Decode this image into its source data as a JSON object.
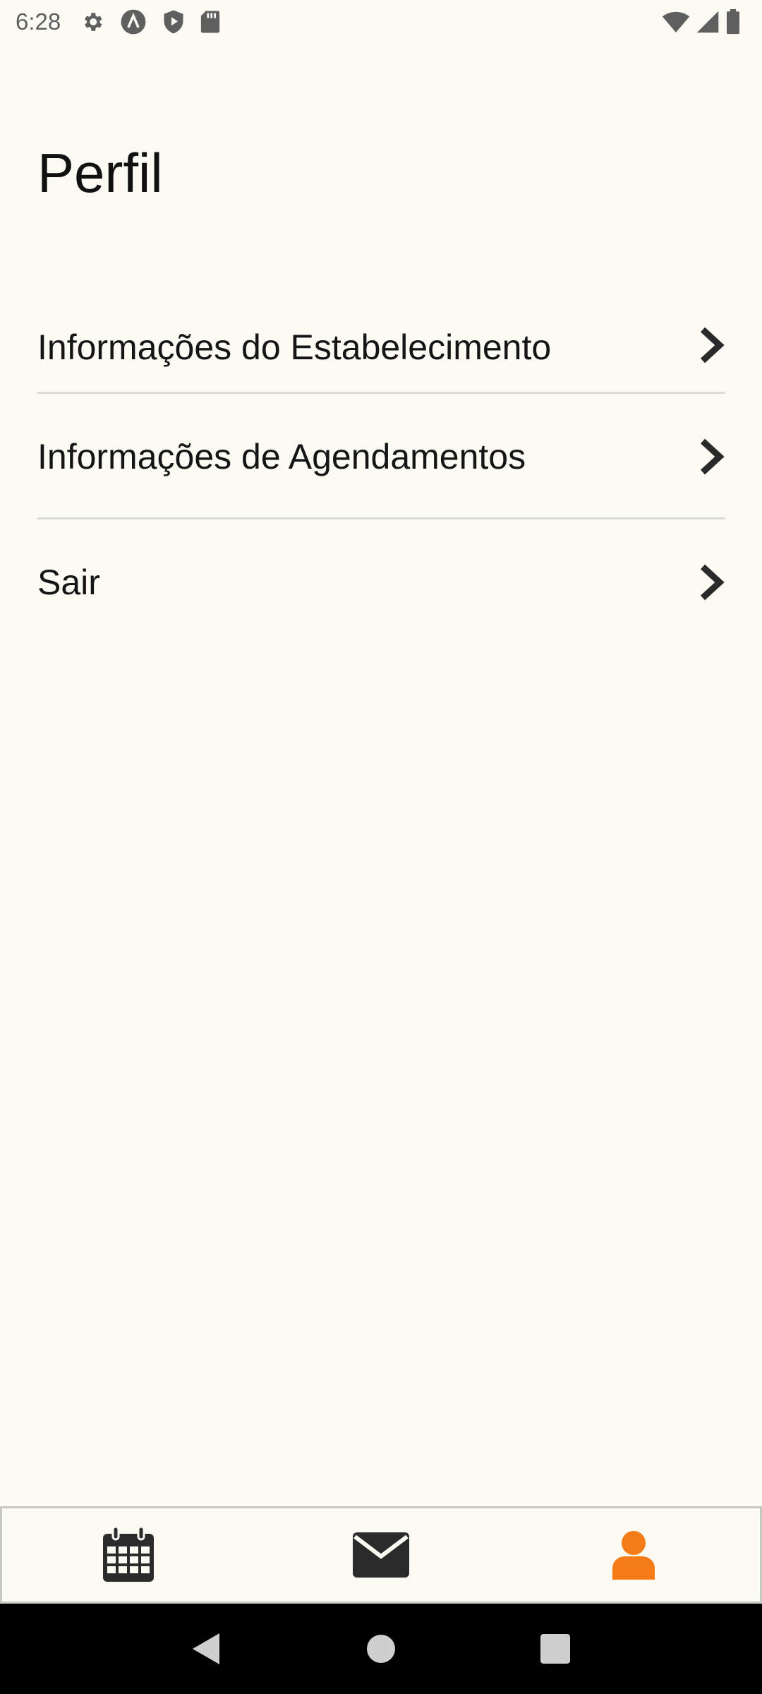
{
  "status_bar": {
    "time": "6:28",
    "left_icons": [
      "gear-icon",
      "a-circle-icon",
      "play-shield-icon",
      "sd-card-icon"
    ],
    "right_icons": [
      "wifi-icon",
      "signal-icon",
      "battery-icon"
    ]
  },
  "page": {
    "title": "Perfil"
  },
  "menu": {
    "items": [
      {
        "label": "Informações do Estabelecimento",
        "icon": "chevron-right-icon"
      },
      {
        "label": "Informações de Agendamentos",
        "icon": "chevron-right-icon"
      },
      {
        "label": "Sair",
        "icon": "chevron-right-icon"
      }
    ]
  },
  "tab_bar": {
    "tabs": [
      {
        "icon": "calendar-icon",
        "active": false
      },
      {
        "icon": "envelope-icon",
        "active": false
      },
      {
        "icon": "user-icon",
        "active": true
      }
    ],
    "colors": {
      "active": "#f47b16",
      "inactive": "#2b2b2b"
    }
  },
  "nav_bar": {
    "buttons": [
      "back-icon",
      "home-icon",
      "recents-icon"
    ]
  }
}
